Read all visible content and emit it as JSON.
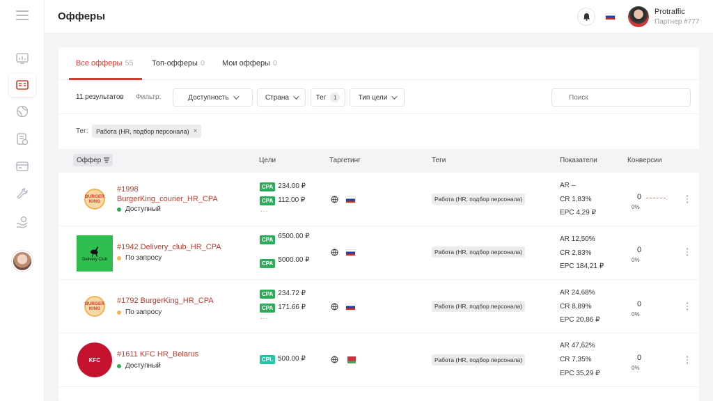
{
  "header": {
    "title": "Офферы",
    "user_name": "Protraffic",
    "user_role": "Партнер #777"
  },
  "tabs": [
    {
      "label": "Все офферы",
      "count": "55"
    },
    {
      "label": "Топ-офферы",
      "count": "0"
    },
    {
      "label": "Мои офферы",
      "count": "0"
    }
  ],
  "filters": {
    "results": "11 результатов",
    "filter_label": "Фильтр:",
    "availability": "Доступность",
    "country": "Страна",
    "tag": "Тег",
    "tag_count": "1",
    "goal_type": "Тип цели",
    "search_placeholder": "Поиск"
  },
  "active_tag": {
    "label": "Тег:",
    "value": "Работа (HR, подбор персонала)",
    "remove": "×"
  },
  "columns": {
    "offer": "Оффер",
    "goals": "Цели",
    "targeting": "Таргетинг",
    "tags": "Теги",
    "metrics": "Показатели",
    "conversions": "Конверсии"
  },
  "offers": [
    {
      "name": "#1998 BurgerKing_courier_HR_CPA",
      "status": "Доступный",
      "goals": [
        {
          "type": "CPA",
          "value": "234.00 ₽"
        },
        {
          "type": "CPA",
          "value": "112.00 ₽"
        }
      ],
      "more": "...",
      "tag": "Работа (HR, подбор персонала)",
      "ar": "AR  –",
      "cr": "CR  1,83%",
      "epc": "EPC 4,29 ₽",
      "conv": "0",
      "conv_pct": "0%"
    },
    {
      "name": "#1942 Delivery_club_HR_CPA",
      "status": "По запросу",
      "goals": [
        {
          "type": "CPA",
          "value": "6500.00 ₽"
        },
        {
          "type": "CPA",
          "value": "5000.00 ₽"
        }
      ],
      "more": "",
      "tag": "Работа (HR, подбор персонала)",
      "ar": "AR  12,50%",
      "cr": "CR  2,83%",
      "epc": "EPC 184,21 ₽",
      "conv": "0",
      "conv_pct": "0%"
    },
    {
      "name": "#1792 BurgerKing_HR_CPA",
      "status": "По запросу",
      "goals": [
        {
          "type": "CPA",
          "value": "234.72 ₽"
        },
        {
          "type": "CPA",
          "value": "171.66 ₽"
        }
      ],
      "more": "...",
      "tag": "Работа (HR, подбор персонала)",
      "ar": "AR  24,68%",
      "cr": "CR  8,89%",
      "epc": "EPC 20,86 ₽",
      "conv": "0",
      "conv_pct": "0%"
    },
    {
      "name": "#1611 KFC HR_Belarus",
      "status": "Доступный",
      "goals": [
        {
          "type": "CPL",
          "value": "500.00 ₽"
        }
      ],
      "more": "",
      "tag": "Работа (HR, подбор персонала)",
      "ar": "AR  47,62%",
      "cr": "CR  7,35%",
      "epc": "EPC 35,29 ₽",
      "conv": "0",
      "conv_pct": "0%"
    }
  ],
  "logos": {
    "bk": "BURGER KING",
    "dc": "Delivery Club",
    "kfc": "KFC"
  },
  "colors": {
    "accent": "#d63b2f",
    "available": "#2eab5a",
    "on_request": "#f0b45b",
    "cpa": "#2eab5a",
    "cpl": "#24c4a6"
  },
  "icons": [
    "menu-icon",
    "dashboard-icon",
    "offers-icon",
    "globe-icon",
    "stats-icon",
    "payment-card-icon",
    "wrench-icon",
    "hand-money-icon",
    "bell-icon",
    "search-icon",
    "sort-icon",
    "kebab-icon"
  ]
}
